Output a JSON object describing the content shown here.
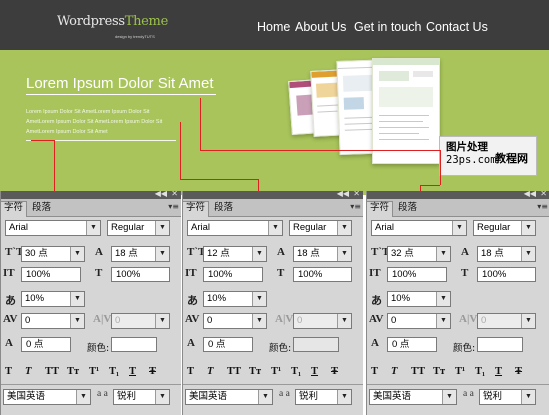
{
  "header": {
    "logo_main": "Wordpress",
    "logo_accent": "Theme",
    "logo_sub": "design by trendyTUTS",
    "accent_color": "#9dc24a",
    "nav": [
      "Home",
      "About Us",
      "Get in touch",
      "Contact Us"
    ]
  },
  "hero": {
    "title": "Lorem Ipsum Dolor Sit Amet",
    "text": "Lorem Ipsum Dolor Sit AmetLorem Ipsum Dolor Sit AmetLorem Ipsum Dolor Sit AmetLorem Ipsum Dolor Sit AmetLorem Ipsum Dolor Sit Amet",
    "banner_color": "#a8c45a"
  },
  "watermark": {
    "line1": "图片处理",
    "line2": "23ps.com",
    "line3": "教程网"
  },
  "annotation_color": "#e02020",
  "panel_ui": {
    "collapse_icon": "◀◀",
    "close_icon": "✕",
    "menu_icon": "▾≡",
    "dropdown_arrow": "▼",
    "color_label": "颜色:",
    "tabs": [
      "字符",
      "段落"
    ],
    "icons": {
      "font_size": "T`T",
      "leading": "A",
      "vscale": "IT",
      "hscale": "T",
      "tracking": "A|V",
      "kerning": "AV",
      "baseline": "A",
      "tsume": "あ"
    },
    "style_buttons": [
      "T",
      "T",
      "TT",
      "Tт",
      "T¹",
      "T₁",
      "T",
      "Ŧ"
    ],
    "aa_label": "a a"
  },
  "panels": [
    {
      "font_family": "Arial",
      "font_style": "Regular",
      "font_size": "30 点",
      "leading": "18 点",
      "vertical_scale": "100%",
      "horizontal_scale": "100%",
      "tsume": "10%",
      "tracking": "0",
      "kerning": "0",
      "baseline_shift": "0 点",
      "language": "美国英语",
      "antialias": "锐利"
    },
    {
      "font_family": "Arial",
      "font_style": "Regular",
      "font_size": "12 点",
      "leading": "18 点",
      "vertical_scale": "100%",
      "horizontal_scale": "100%",
      "tsume": "10%",
      "tracking": "0",
      "kerning": "0",
      "baseline_shift": "0 点",
      "language": "美国英语",
      "antialias": "锐利"
    },
    {
      "font_family": "Arial",
      "font_style": "Regular",
      "font_size": "32 点",
      "leading": "18 点",
      "vertical_scale": "100%",
      "horizontal_scale": "100%",
      "tsume": "10%",
      "tracking": "0",
      "kerning": "0",
      "baseline_shift": "0 点",
      "language": "美国英语",
      "antialias": "锐利"
    }
  ]
}
